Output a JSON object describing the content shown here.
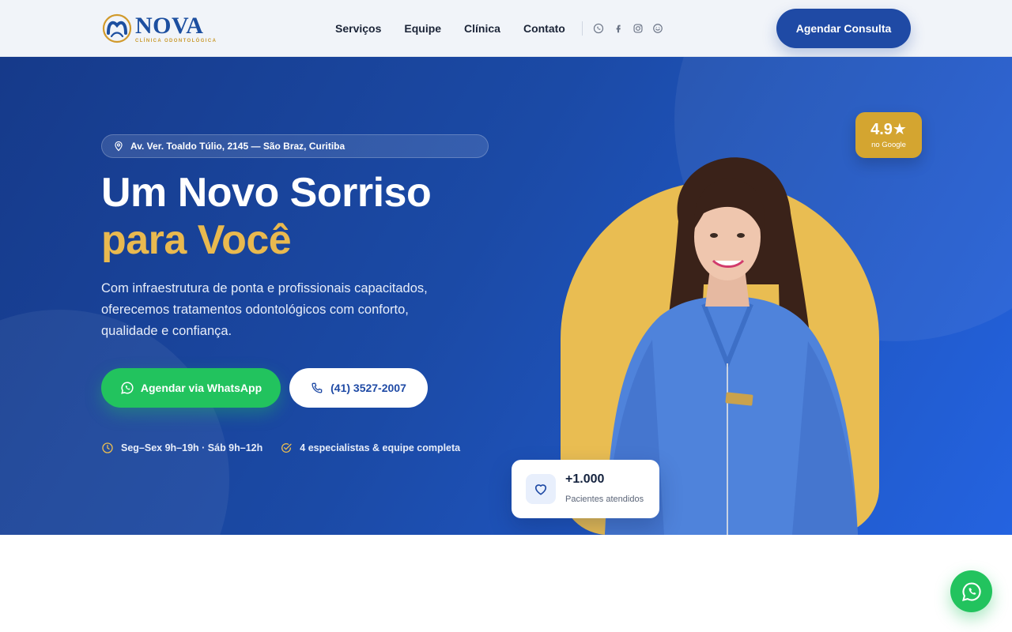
{
  "header": {
    "brand": {
      "name": "NOVA",
      "tagline": "CLÍNICA ODONTOLÓGICA"
    },
    "nav": [
      "Serviços",
      "Equipe",
      "Clínica",
      "Contato"
    ],
    "socials": [
      "whatsapp-icon",
      "facebook-icon",
      "instagram-icon",
      "messenger-icon"
    ],
    "cta_label": "Agendar Consulta"
  },
  "hero": {
    "address": "Av. Ver. Toaldo Túlio, 2145 — São Braz, Curitiba",
    "title_line1": "Um Novo Sorriso",
    "title_line2": "para Você",
    "lead": "Com infraestrutura de ponta e profissionais capacitados, oferecemos tratamentos odontológicos com conforto, qualidade e confiança.",
    "btn_whatsapp": "Agendar via WhatsApp",
    "btn_phone": "(41) 3527-2007",
    "hours": "Seg–Sex 9h–19h  ·  Sáb 9h–12h",
    "team": "4 especialistas & equipe completa",
    "rating": {
      "value": "4.9★",
      "source": "no Google"
    },
    "patients": {
      "value": "+1.000",
      "label": "Pacientes atendidos"
    }
  },
  "colors": {
    "primary": "#1f4aa5",
    "accent_gold": "#e9bd52",
    "whatsapp_green": "#22c35e",
    "hero_gradient_start": "#163a8a",
    "hero_gradient_end": "#2463e0"
  }
}
